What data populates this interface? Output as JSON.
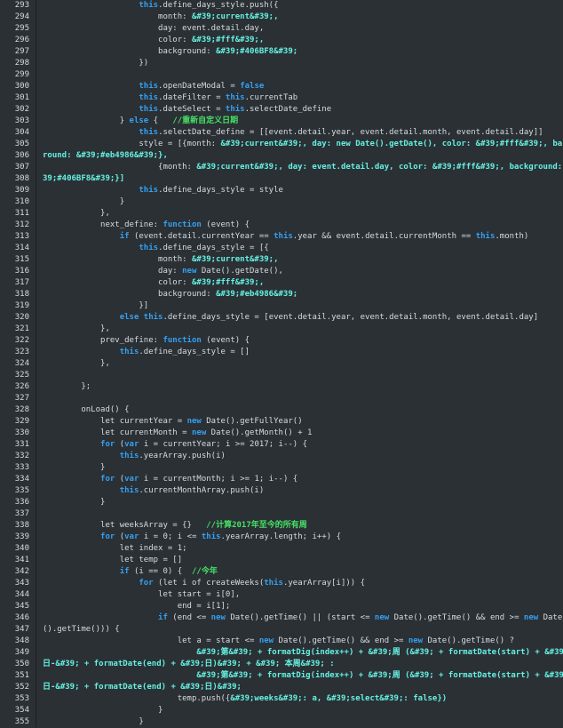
{
  "colors": {
    "background": "#2b3035",
    "text": "#d6dbe0",
    "keyword": "#35a0f0",
    "string": "#64f0e0",
    "comment": "#46e066"
  },
  "lines": [
    {
      "n": "293",
      "segs": [
        [
          "p",
          "                    "
        ],
        [
          "k",
          "this"
        ],
        [
          "p",
          ".define_days_style.push({"
        ]
      ]
    },
    {
      "n": "294",
      "segs": [
        [
          "p",
          "                        month: "
        ],
        [
          "s",
          "&#39;current&#39;,"
        ]
      ]
    },
    {
      "n": "295",
      "segs": [
        [
          "p",
          "                        day: event.detail.day,"
        ]
      ]
    },
    {
      "n": "296",
      "segs": [
        [
          "p",
          "                        color: "
        ],
        [
          "s",
          "&#39;#fff&#39;,"
        ]
      ]
    },
    {
      "n": "297",
      "segs": [
        [
          "p",
          "                        background: "
        ],
        [
          "s",
          "&#39;#406BF8&#39;"
        ]
      ]
    },
    {
      "n": "298",
      "segs": [
        [
          "p",
          "                    })"
        ]
      ]
    },
    {
      "n": "299",
      "segs": []
    },
    {
      "n": "300",
      "segs": [
        [
          "p",
          "                    "
        ],
        [
          "k",
          "this"
        ],
        [
          "p",
          ".openDateModal = "
        ],
        [
          "k",
          "false"
        ]
      ]
    },
    {
      "n": "301",
      "segs": [
        [
          "p",
          "                    "
        ],
        [
          "k",
          "this"
        ],
        [
          "p",
          ".dateFilter = "
        ],
        [
          "k",
          "this"
        ],
        [
          "p",
          ".currentTab"
        ]
      ]
    },
    {
      "n": "302",
      "segs": [
        [
          "p",
          "                    "
        ],
        [
          "k",
          "this"
        ],
        [
          "p",
          ".dateSelect = "
        ],
        [
          "k",
          "this"
        ],
        [
          "p",
          ".selectDate_define"
        ]
      ]
    },
    {
      "n": "303",
      "segs": [
        [
          "p",
          "                } "
        ],
        [
          "k",
          "else"
        ],
        [
          "p",
          " {   "
        ],
        [
          "c",
          "//重新自定义日期"
        ]
      ]
    },
    {
      "n": "304",
      "segs": [
        [
          "p",
          "                    "
        ],
        [
          "k",
          "this"
        ],
        [
          "p",
          ".selectDate_define = [[event.detail.year, event.detail.month, event.detail.day]]"
        ]
      ]
    },
    {
      "n": "305",
      "segs": [
        [
          "p",
          "                    style = [{month: "
        ],
        [
          "s",
          "&#39;current&#39;, day: new Date().getDate(), color: &#39;#fff&#39;, backg"
        ]
      ]
    },
    {
      "n": "306",
      "segs": [
        [
          "s",
          "round: &#39;#eb4986&#39;},"
        ]
      ],
      "wrap": true
    },
    {
      "n": "307",
      "segs": [
        [
          "p",
          "                        {month: "
        ],
        [
          "s",
          "&#39;current&#39;, day: event.detail.day, color: &#39;#fff&#39;, background: &#"
        ]
      ]
    },
    {
      "n": "308",
      "segs": [
        [
          "s",
          "39;#406BF8&#39;}]"
        ]
      ],
      "wrap": true
    },
    {
      "n": "309",
      "segs": [
        [
          "p",
          "                    "
        ],
        [
          "k",
          "this"
        ],
        [
          "p",
          ".define_days_style = style"
        ]
      ]
    },
    {
      "n": "310",
      "segs": [
        [
          "p",
          "                }"
        ]
      ]
    },
    {
      "n": "311",
      "segs": [
        [
          "p",
          "            },"
        ]
      ]
    },
    {
      "n": "312",
      "segs": [
        [
          "p",
          "            next_define: "
        ],
        [
          "k",
          "function"
        ],
        [
          "p",
          " (event) {"
        ]
      ]
    },
    {
      "n": "313",
      "segs": [
        [
          "p",
          "                "
        ],
        [
          "k",
          "if"
        ],
        [
          "p",
          " (event.detail.currentYear == "
        ],
        [
          "k",
          "this"
        ],
        [
          "p",
          ".year && event.detail.currentMonth == "
        ],
        [
          "k",
          "this"
        ],
        [
          "p",
          ".month)"
        ]
      ]
    },
    {
      "n": "314",
      "segs": [
        [
          "p",
          "                    "
        ],
        [
          "k",
          "this"
        ],
        [
          "p",
          ".define_days_style = [{"
        ]
      ]
    },
    {
      "n": "315",
      "segs": [
        [
          "p",
          "                        month: "
        ],
        [
          "s",
          "&#39;current&#39;,"
        ]
      ]
    },
    {
      "n": "316",
      "segs": [
        [
          "p",
          "                        day: "
        ],
        [
          "k",
          "new"
        ],
        [
          "p",
          " Date().getDate(),"
        ]
      ]
    },
    {
      "n": "317",
      "segs": [
        [
          "p",
          "                        color: "
        ],
        [
          "s",
          "&#39;#fff&#39;,"
        ]
      ]
    },
    {
      "n": "318",
      "segs": [
        [
          "p",
          "                        background: "
        ],
        [
          "s",
          "&#39;#eb4986&#39;"
        ]
      ]
    },
    {
      "n": "319",
      "segs": [
        [
          "p",
          "                    }]"
        ]
      ]
    },
    {
      "n": "320",
      "segs": [
        [
          "p",
          "                "
        ],
        [
          "k",
          "else this"
        ],
        [
          "p",
          ".define_days_style = [event.detail.year, event.detail.month, event.detail.day]"
        ]
      ]
    },
    {
      "n": "321",
      "segs": [
        [
          "p",
          "            },"
        ]
      ]
    },
    {
      "n": "322",
      "segs": [
        [
          "p",
          "            prev_define: "
        ],
        [
          "k",
          "function"
        ],
        [
          "p",
          " (event) {"
        ]
      ]
    },
    {
      "n": "323",
      "segs": [
        [
          "p",
          "                "
        ],
        [
          "k",
          "this"
        ],
        [
          "p",
          ".define_days_style = []"
        ]
      ]
    },
    {
      "n": "324",
      "segs": [
        [
          "p",
          "            },"
        ]
      ]
    },
    {
      "n": "325",
      "segs": []
    },
    {
      "n": "326",
      "segs": [
        [
          "p",
          "        };"
        ]
      ]
    },
    {
      "n": "327",
      "segs": []
    },
    {
      "n": "328",
      "segs": [
        [
          "p",
          "        onLoad() {"
        ]
      ]
    },
    {
      "n": "329",
      "segs": [
        [
          "p",
          "            let currentYear = "
        ],
        [
          "k",
          "new"
        ],
        [
          "p",
          " Date().getFullYear()"
        ]
      ]
    },
    {
      "n": "330",
      "segs": [
        [
          "p",
          "            let currentMonth = "
        ],
        [
          "k",
          "new"
        ],
        [
          "p",
          " Date().getMonth() + 1"
        ]
      ]
    },
    {
      "n": "331",
      "segs": [
        [
          "p",
          "            "
        ],
        [
          "k",
          "for"
        ],
        [
          "p",
          " ("
        ],
        [
          "k",
          "var"
        ],
        [
          "p",
          " i = currentYear; i >= 2017; i--) {"
        ]
      ]
    },
    {
      "n": "332",
      "segs": [
        [
          "p",
          "                "
        ],
        [
          "k",
          "this"
        ],
        [
          "p",
          ".yearArray.push(i)"
        ]
      ]
    },
    {
      "n": "333",
      "segs": [
        [
          "p",
          "            }"
        ]
      ]
    },
    {
      "n": "334",
      "segs": [
        [
          "p",
          "            "
        ],
        [
          "k",
          "for"
        ],
        [
          "p",
          " ("
        ],
        [
          "k",
          "var"
        ],
        [
          "p",
          " i = currentMonth; i >= 1; i--) {"
        ]
      ]
    },
    {
      "n": "335",
      "segs": [
        [
          "p",
          "                "
        ],
        [
          "k",
          "this"
        ],
        [
          "p",
          ".currentMonthArray.push(i)"
        ]
      ]
    },
    {
      "n": "336",
      "segs": [
        [
          "p",
          "            }"
        ]
      ]
    },
    {
      "n": "337",
      "segs": []
    },
    {
      "n": "338",
      "segs": [
        [
          "p",
          "            let weeksArray = {}   "
        ],
        [
          "c",
          "//计算2017年至今的所有周"
        ]
      ]
    },
    {
      "n": "339",
      "segs": [
        [
          "p",
          "            "
        ],
        [
          "k",
          "for"
        ],
        [
          "p",
          " ("
        ],
        [
          "k",
          "var"
        ],
        [
          "p",
          " i = 0; i <= "
        ],
        [
          "k",
          "this"
        ],
        [
          "p",
          ".yearArray.length; i++) {"
        ]
      ]
    },
    {
      "n": "340",
      "segs": [
        [
          "p",
          "                let index = 1;"
        ]
      ]
    },
    {
      "n": "341",
      "segs": [
        [
          "p",
          "                let temp = []"
        ]
      ]
    },
    {
      "n": "342",
      "segs": [
        [
          "p",
          "                "
        ],
        [
          "k",
          "if"
        ],
        [
          "p",
          " (i == 0) {  "
        ],
        [
          "c",
          "//今年"
        ]
      ]
    },
    {
      "n": "343",
      "segs": [
        [
          "p",
          "                    "
        ],
        [
          "k",
          "for"
        ],
        [
          "p",
          " (let i of createWeeks("
        ],
        [
          "k",
          "this"
        ],
        [
          "p",
          ".yearArray[i])) {"
        ]
      ]
    },
    {
      "n": "344",
      "segs": [
        [
          "p",
          "                        let start = i[0],"
        ]
      ]
    },
    {
      "n": "345",
      "segs": [
        [
          "p",
          "                            end = i[1];"
        ]
      ]
    },
    {
      "n": "346",
      "segs": [
        [
          "p",
          "                        "
        ],
        [
          "k",
          "if"
        ],
        [
          "p",
          " (end <= "
        ],
        [
          "k",
          "new"
        ],
        [
          "p",
          " Date().getTime() || (start <= "
        ],
        [
          "k",
          "new"
        ],
        [
          "p",
          " Date().getTime() && end >= "
        ],
        [
          "k",
          "new"
        ],
        [
          "p",
          " Date"
        ]
      ]
    },
    {
      "n": "347",
      "segs": [
        [
          "p",
          "().getTime())) {"
        ]
      ],
      "wrap": true
    },
    {
      "n": "348",
      "segs": [
        [
          "p",
          "                            let a = start <= "
        ],
        [
          "k",
          "new"
        ],
        [
          "p",
          " Date().getTime() && end >= "
        ],
        [
          "k",
          "new"
        ],
        [
          "p",
          " Date().getTime() ?"
        ]
      ]
    },
    {
      "n": "349",
      "segs": [
        [
          "p",
          "                                "
        ],
        [
          "s",
          "&#39;第&#39; + formatDig(index++) + &#39;周 (&#39; + formatDate(start) + &#39;"
        ]
      ]
    },
    {
      "n": "350",
      "segs": [
        [
          "s",
          "日-&#39; + formatDate(end) + &#39;日)&#39; + &#39; 本周&#39; :"
        ]
      ],
      "wrap": true
    },
    {
      "n": "351",
      "segs": [
        [
          "p",
          "                                "
        ],
        [
          "s",
          "&#39;第&#39; + formatDig(index++) + &#39;周 (&#39; + formatDate(start) + &#39;"
        ]
      ]
    },
    {
      "n": "352",
      "segs": [
        [
          "s",
          "日-&#39; + formatDate(end) + &#39;日)&#39;"
        ]
      ],
      "wrap": true
    },
    {
      "n": "353",
      "segs": [
        [
          "p",
          "                            temp.push({"
        ],
        [
          "s",
          "&#39;weeks&#39;: a, &#39;select&#39;: false})"
        ]
      ]
    },
    {
      "n": "354",
      "segs": [
        [
          "p",
          "                        }"
        ]
      ]
    },
    {
      "n": "355",
      "segs": [
        [
          "p",
          "                    }"
        ]
      ]
    }
  ]
}
